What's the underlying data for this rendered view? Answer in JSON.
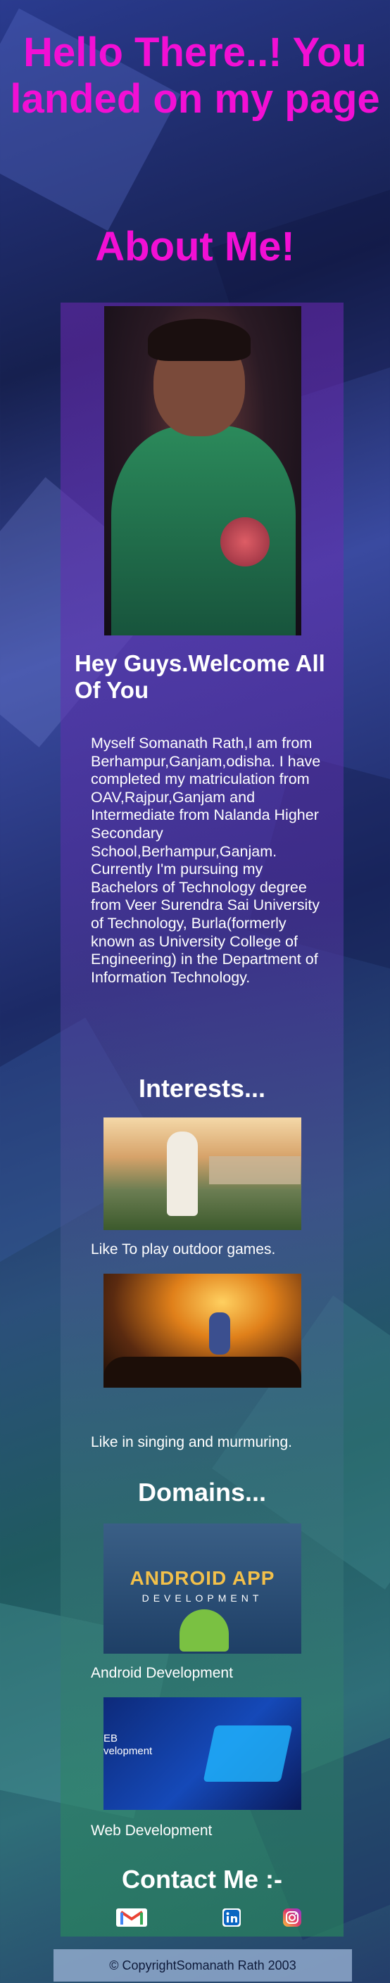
{
  "header": {
    "hello": "Hello There..! You landed on my page",
    "about": "About Me!"
  },
  "profile": {
    "welcome": "Hey Guys.Welcome All Of You",
    "bio": "Myself Somanath Rath,I am from Berhampur,Ganjam,odisha. I have completed my matriculation from OAV,Rajpur,Ganjam and Intermediate from Nalanda Higher Secondary School,Berhampur,Ganjam. Currently I'm pursuing my Bachelors of Technology degree from Veer Surendra Sai University of Technology, Burla(formerly known as University College of Engineering) in the Department of Information Technology."
  },
  "interests": {
    "title": "Interests...",
    "items": [
      {
        "caption": "Like To play outdoor games."
      },
      {
        "caption": "Like in singing and murmuring."
      }
    ]
  },
  "domains": {
    "title": "Domains...",
    "items": [
      {
        "caption": "Android Development",
        "image_text": "ANDROID APP",
        "image_subtext": "DEVELOPMENT"
      },
      {
        "caption": "Web Development",
        "image_text": "EB\nvelopment"
      }
    ]
  },
  "contact": {
    "title": "Contact Me :-",
    "icons": [
      "gmail-icon",
      "linkedin-icon",
      "instagram-icon"
    ]
  },
  "footer": {
    "text": "© CopyrightSomanath Rath 2003"
  },
  "colors": {
    "heading": "#f20fd4",
    "text": "#ffffff",
    "footer_bg": "#96afd2"
  }
}
